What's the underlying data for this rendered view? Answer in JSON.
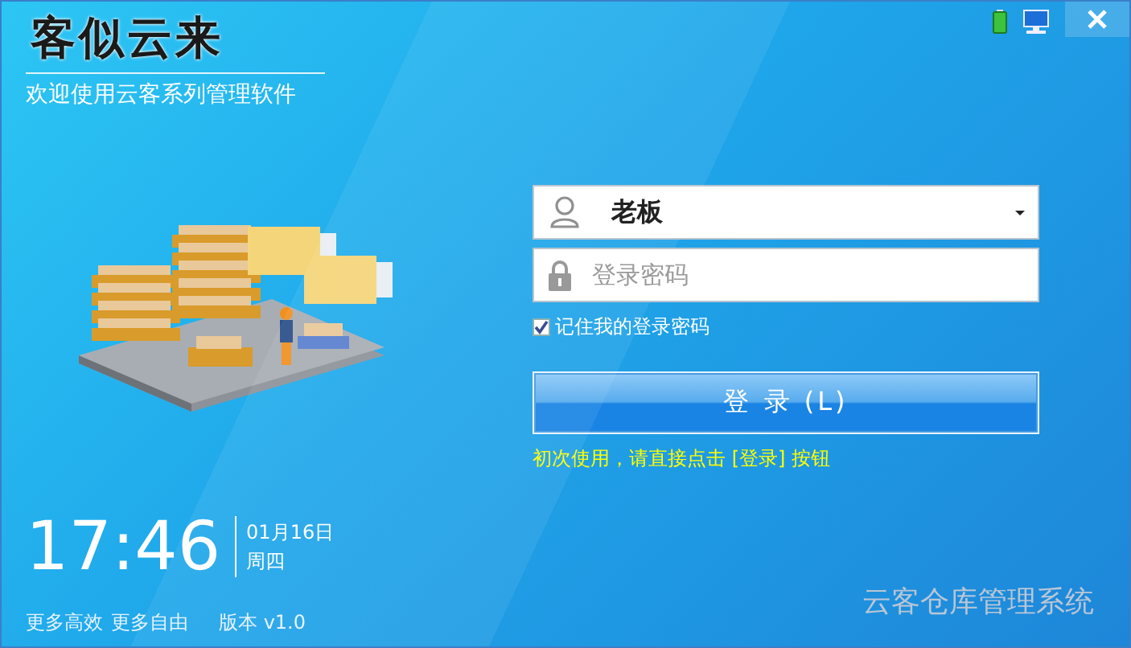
{
  "logo": {
    "text": "客似云来"
  },
  "subtitle": "欢迎使用云客系列管理软件",
  "login": {
    "username": {
      "value": "老板"
    },
    "password": {
      "placeholder": "登录密码"
    },
    "remember": {
      "label": "记住我的登录密码",
      "checked": true
    },
    "button": {
      "label": "登 录 (L)"
    },
    "hint": "初次使用，请直接点击 [登录] 按钮"
  },
  "clock": {
    "time": "17:46",
    "date": "01月16日",
    "weekday": "周四"
  },
  "footer": {
    "slogans": [
      "更多高效",
      "更多自由"
    ],
    "version": "版本 v1.0",
    "product_name": "云客仓库管理系统"
  }
}
